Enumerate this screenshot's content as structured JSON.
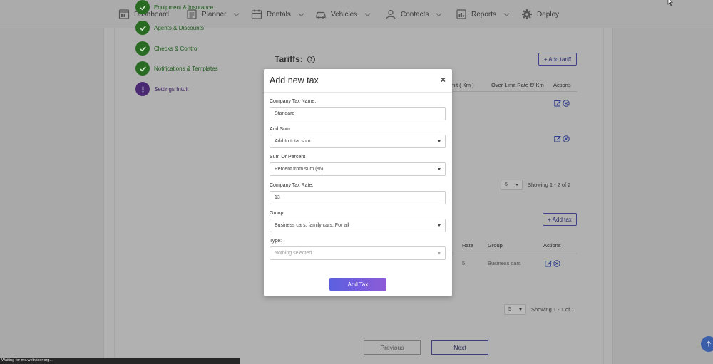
{
  "nav": {
    "items": [
      {
        "label": "Dashboard",
        "icon": "dashboard-icon",
        "has_menu": false
      },
      {
        "label": "Planner",
        "icon": "planner-icon",
        "has_menu": true
      },
      {
        "label": "Rentals",
        "icon": "rentals-icon",
        "has_menu": true
      },
      {
        "label": "Vehicles",
        "icon": "vehicles-icon",
        "has_menu": true
      },
      {
        "label": "Contacts",
        "icon": "contacts-icon",
        "has_menu": true
      },
      {
        "label": "Reports",
        "icon": "reports-icon",
        "has_menu": true
      },
      {
        "label": "Deploy",
        "icon": "gear-icon",
        "has_menu": false
      }
    ]
  },
  "steps": [
    {
      "label": "Equipment & Insurance",
      "status": "done"
    },
    {
      "label": "Agents & Discounts",
      "status": "done"
    },
    {
      "label": "Checks & Control",
      "status": "done"
    },
    {
      "label": "Notifications & Templates",
      "status": "done"
    },
    {
      "label": "Settings Intuit",
      "status": "warning"
    }
  ],
  "tariffs": {
    "title": "Tariffs:",
    "help": "?",
    "add_label": "+ Add tariff",
    "columns": [
      "e Limit ( Km )",
      "Over Limit Rate €/ Km",
      "Actions"
    ],
    "pager": {
      "page_size": "5",
      "showing": "Showing 1 - 2 of 2"
    }
  },
  "taxes": {
    "add_label": "+ Add tax",
    "columns": [
      "Rate",
      "Group",
      "Actions"
    ],
    "rows": [
      {
        "rate": "5",
        "group": "Business cars"
      }
    ],
    "pager": {
      "page_size": "5",
      "showing": "Showing 1 - 1 of 1"
    }
  },
  "pagination": {
    "previous": "Previous",
    "next": "Next"
  },
  "modal": {
    "title": "Add new tax",
    "close": "×",
    "fields": {
      "name": {
        "label": "Company Tax Name:",
        "value": "Standard"
      },
      "add_sum": {
        "label": "Add Sum",
        "value": "Add to total sum"
      },
      "sum_or_percent": {
        "label": "Sum Or Percent",
        "value": "Percent from sum (%)"
      },
      "rate": {
        "label": "Company Tax Rate:",
        "value": "13"
      },
      "group": {
        "label": "Group:",
        "value": "Business cars, family cars, For all"
      },
      "type": {
        "label": "Type:",
        "placeholder": "Nothing selected"
      }
    },
    "submit_label": "Add Tax"
  },
  "status_bar": "Waiting for mc.webvisor.org..."
}
